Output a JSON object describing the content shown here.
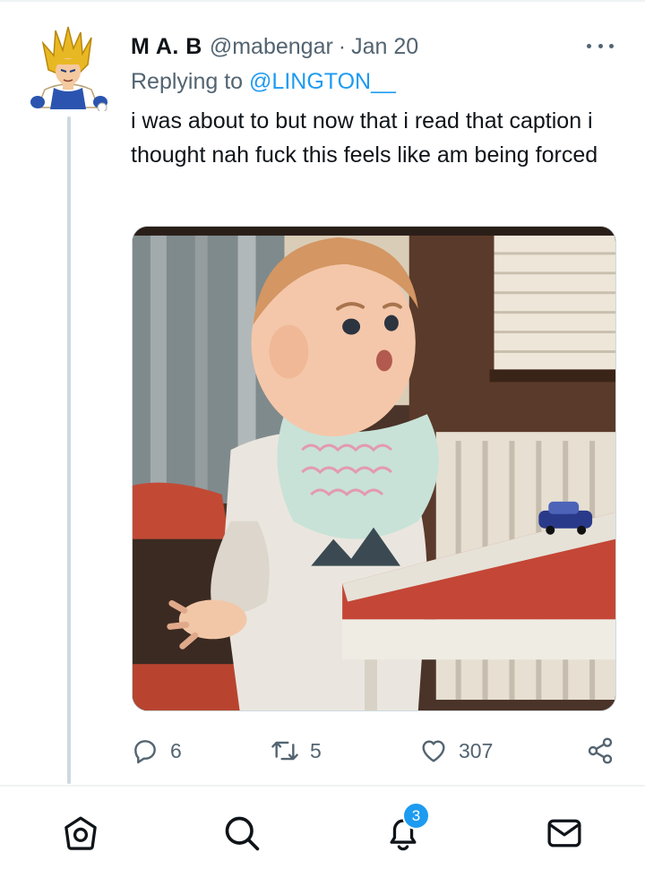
{
  "tweet": {
    "author_name": "M A. B",
    "author_handle": "@mabengar",
    "separator": "·",
    "date": "Jan 20",
    "replying_prefix": "Replying to",
    "replying_to": "@LINGTON__",
    "text": "i was about to but now that i read that caption i thought nah fuck this feels like am being forced",
    "media_icon": "toddler-shrug-photo"
  },
  "actions": {
    "reply_count": "6",
    "retweet_count": "5",
    "like_count": "307",
    "reply_icon": "reply-icon",
    "retweet_icon": "retweet-icon",
    "like_icon": "heart-icon",
    "share_icon": "share-icon"
  },
  "bottom_nav": {
    "items": [
      "home-icon",
      "search-icon",
      "notifications-icon",
      "messages-icon"
    ],
    "notifications_badge": "3"
  },
  "colors": {
    "accent": "#1d9bf0",
    "text_primary": "#0f1419",
    "text_secondary": "#536471",
    "divider": "#eff3f4",
    "thread_line": "#cfd9de"
  }
}
